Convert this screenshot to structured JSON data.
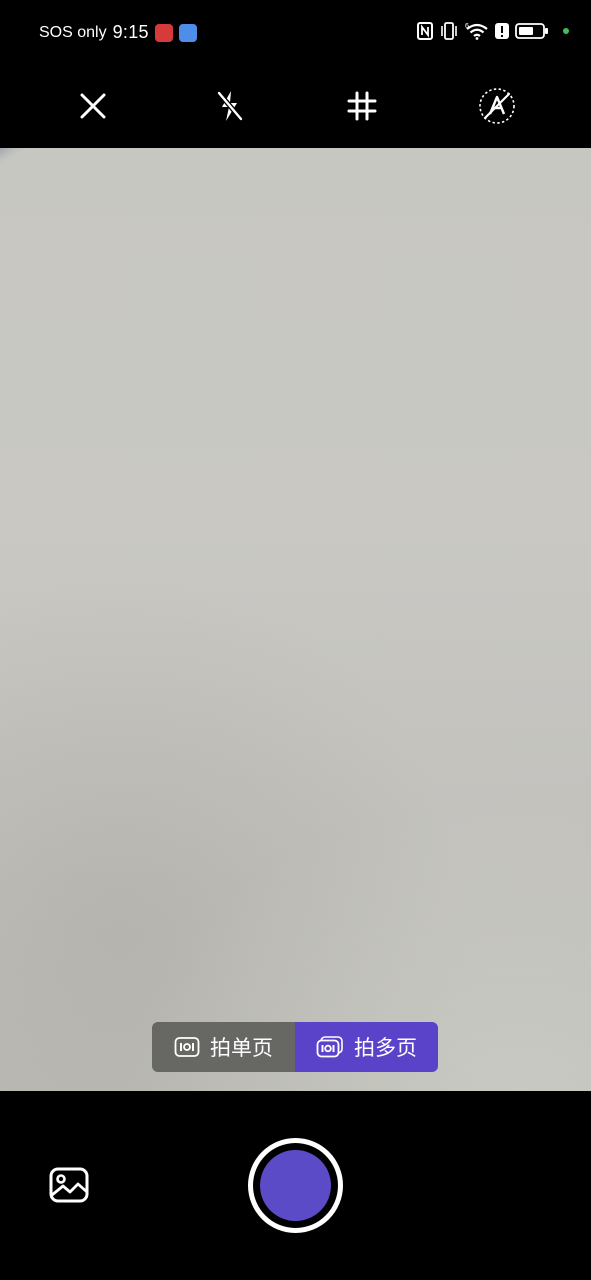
{
  "status_bar": {
    "carrier": "SOS only",
    "time": "9:15",
    "notification_icons": [
      "app-notification-red-icon",
      "app-notification-blue-icon"
    ],
    "system_icons": [
      "nfc-icon",
      "vibrate-icon",
      "wifi-icon",
      "alert-icon",
      "battery-icon"
    ],
    "wifi_label": "6",
    "alert_label": "!"
  },
  "toolbar": {
    "buttons": [
      {
        "name": "close",
        "icon": "close-icon"
      },
      {
        "name": "flash",
        "icon": "flash-off-icon"
      },
      {
        "name": "grid",
        "icon": "grid-icon"
      },
      {
        "name": "auto-enhance",
        "icon": "auto-enhance-off-icon"
      }
    ]
  },
  "mode_toggle": {
    "single_label": "拍单页",
    "multi_label": "拍多页",
    "selected": "multi",
    "selected_color": "#5b43c9"
  },
  "bottom": {
    "gallery_icon": "gallery-icon",
    "shutter_color": "#5b4bc7"
  }
}
